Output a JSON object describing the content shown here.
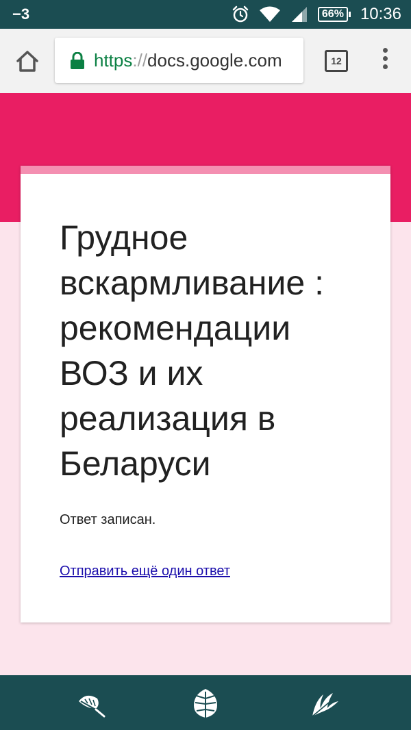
{
  "status_bar": {
    "left_indicator": "−3",
    "battery": "66%",
    "time": "10:36"
  },
  "browser": {
    "url_scheme": "https",
    "url_separator": "://",
    "url_host": "docs.google.com",
    "tab_count": "12"
  },
  "form": {
    "title": "Грудное вскармливание : рекомендации ВОЗ и их реализация в Беларуси",
    "confirmation": "Ответ записан.",
    "submit_another_link": "Отправить ещё один ответ"
  },
  "colors": {
    "header_pink": "#e91e63",
    "accent_pink": "#f48fb1",
    "page_background": "#fce4ec",
    "system_bar": "#1b4d52",
    "secure_green": "#0b8043",
    "link_blue": "#1a0dab"
  },
  "icons": {
    "status": [
      "alarm-icon",
      "wifi-icon",
      "signal-icon",
      "battery-icon"
    ],
    "toolbar": [
      "home-icon",
      "lock-icon",
      "tab-switcher-icon",
      "overflow-menu-icon"
    ],
    "bottom_nav": [
      "feather-leaf-icon",
      "monstera-leaf-icon",
      "palm-leaf-icon"
    ]
  }
}
